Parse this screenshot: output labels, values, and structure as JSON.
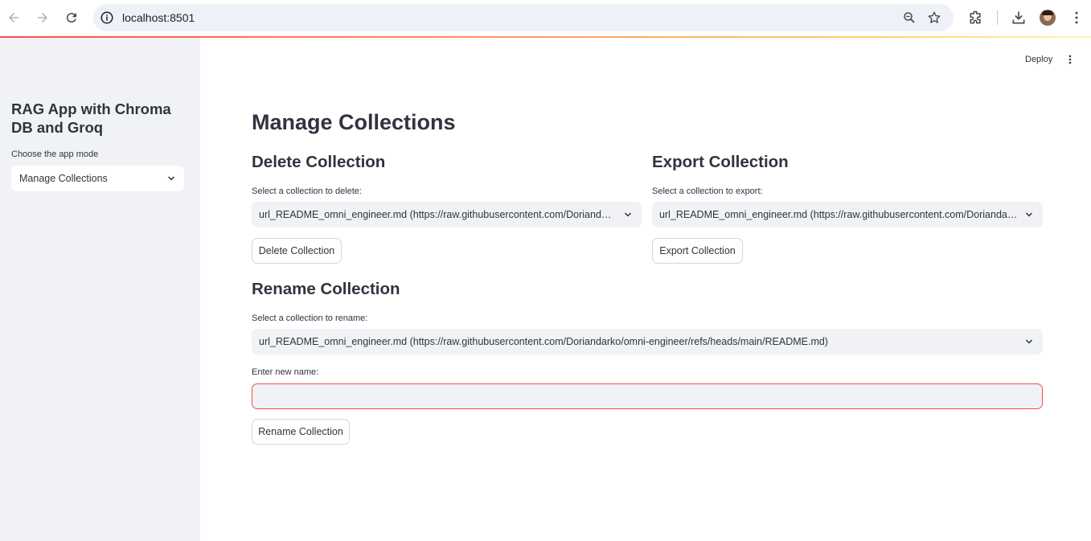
{
  "browser": {
    "url": "localhost:8501"
  },
  "sidebar": {
    "title": "RAG App with Chroma DB and Groq",
    "mode_label": "Choose the app mode",
    "mode_value": "Manage Collections"
  },
  "header": {
    "deploy_label": "Deploy"
  },
  "main": {
    "title": "Manage Collections",
    "delete": {
      "heading": "Delete Collection",
      "label": "Select a collection to delete:",
      "value": "url_README_omni_engineer.md (https://raw.githubusercontent.com/Doriandarko/omni-engineer/refs/heads/main/README.md)",
      "button": "Delete Collection"
    },
    "export": {
      "heading": "Export Collection",
      "label": "Select a collection to export:",
      "value": "url_README_omni_engineer.md (https://raw.githubusercontent.com/Doriandarko/omni-engineer/refs/heads/main/README.md)",
      "button": "Export Collection"
    },
    "rename": {
      "heading": "Rename Collection",
      "label": "Select a collection to rename:",
      "value": "url_README_omni_engineer.md (https://raw.githubusercontent.com/Doriandarko/omni-engineer/refs/heads/main/README.md)",
      "new_name_label": "Enter new name:",
      "new_name_value": "",
      "button": "Rename Collection"
    }
  },
  "colors": {
    "accent": "#ff4b4b",
    "sidebar_bg": "#f0f2f6",
    "text": "#31333f"
  }
}
